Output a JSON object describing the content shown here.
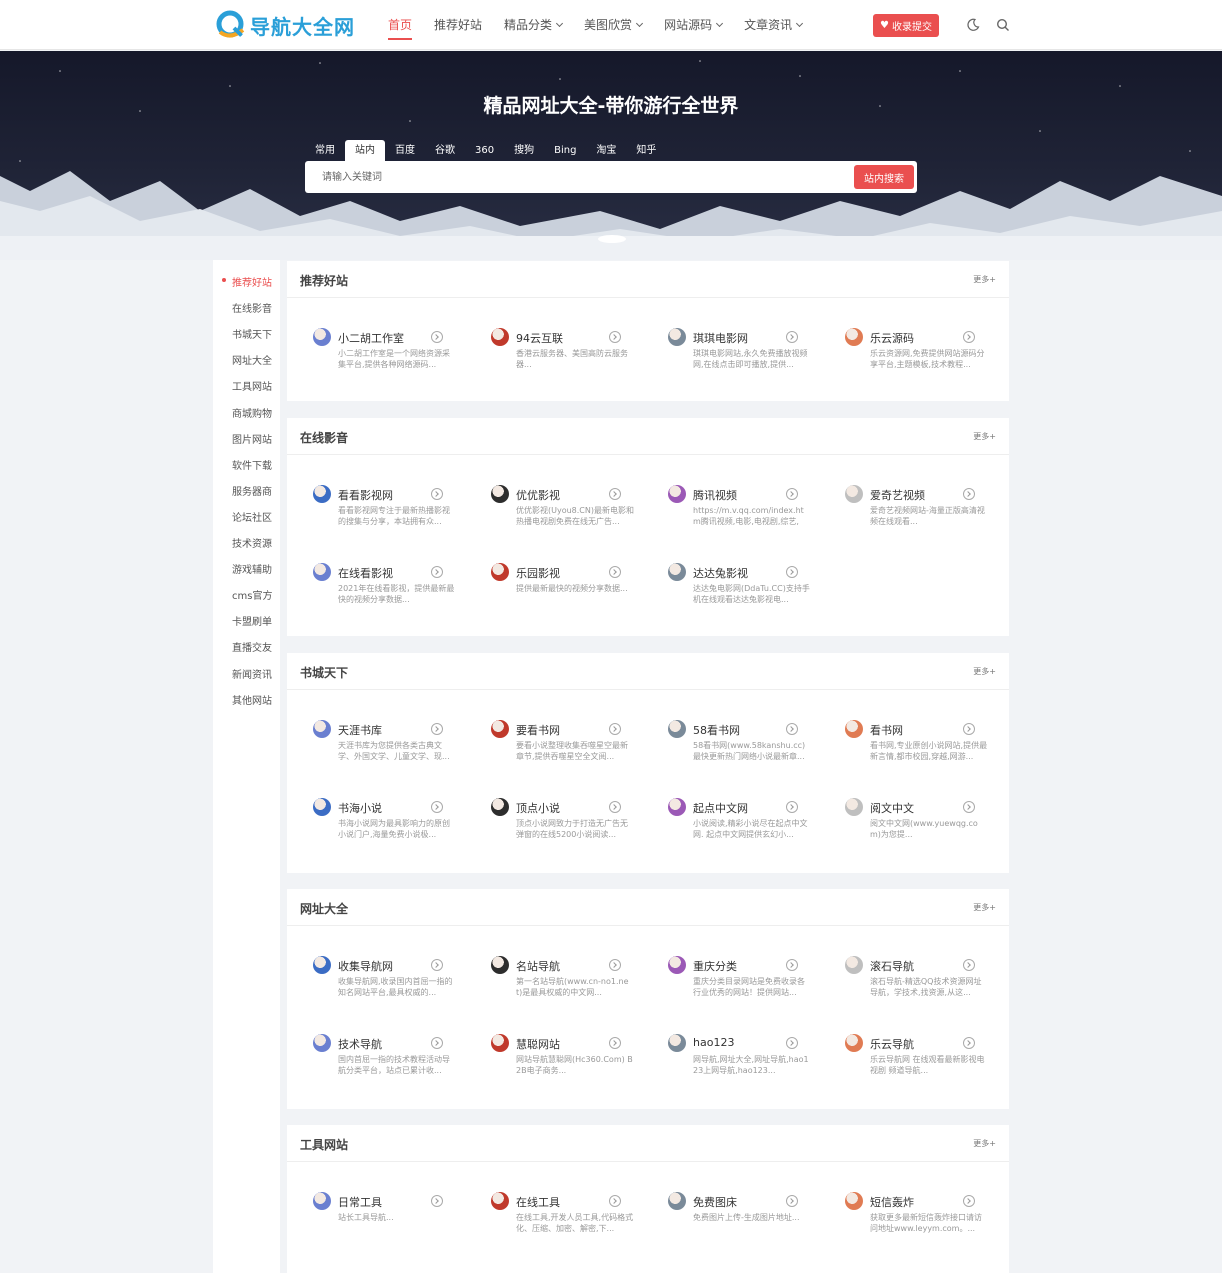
{
  "logo": {
    "text": "导航大全网"
  },
  "nav": [
    {
      "label": "首页",
      "active": true,
      "dropdown": false
    },
    {
      "label": "推荐好站",
      "active": false,
      "dropdown": false
    },
    {
      "label": "精品分类",
      "active": false,
      "dropdown": true
    },
    {
      "label": "美图欣赏",
      "active": false,
      "dropdown": true
    },
    {
      "label": "网站源码",
      "active": false,
      "dropdown": true
    },
    {
      "label": "文章资讯",
      "active": false,
      "dropdown": true
    }
  ],
  "header": {
    "submit_label": "收录提交",
    "submit_icon": "heart-icon",
    "theme_icon": "moon-icon",
    "search_icon": "search-icon"
  },
  "banner": {
    "title": "精品网址大全-带你游行全世界",
    "tabs": [
      "常用",
      "站内",
      "百度",
      "谷歌",
      "360",
      "搜狗",
      "Bing",
      "淘宝",
      "知乎"
    ],
    "active_tab": "站内",
    "search_placeholder": "请输入关键词",
    "search_button": "站内搜索"
  },
  "side": {
    "active": "推荐好站",
    "items": [
      "推荐好站",
      "在线影音",
      "书城天下",
      "网址大全",
      "工具网站",
      "商城购物",
      "图片网站",
      "软件下载",
      "服务器商",
      "论坛社区",
      "技术资源",
      "游戏辅助",
      "cms官方",
      "卡盟刷单",
      "直播交友",
      "新闻资讯",
      "其他网站"
    ]
  },
  "more_label": "更多+",
  "colors": {
    "accent": "#ea4f4f",
    "banner_dark": "#1f2336"
  },
  "sections": [
    {
      "title": "推荐好站",
      "items": [
        {
          "name": "小二胡工作室",
          "desc": "小二胡工作室是一个网络资源采集平台,提供各种网络源码..."
        },
        {
          "name": "94云互联",
          "desc": "香港云服务器、美国高防云服务器..."
        },
        {
          "name": "琪琪电影网",
          "desc": "琪琪电影网站,永久免费播放视频网,在线点击即可播放,提供..."
        },
        {
          "name": "乐云源码",
          "desc": "乐云资源网,免费提供网站源码分享平台,主题模板,技术教程..."
        }
      ]
    },
    {
      "title": "在线影音",
      "items": [
        {
          "name": "看看影视网",
          "desc": "看看影视网专注于最新热播影视的搜集与分享，本站拥有众..."
        },
        {
          "name": "优优影视",
          "desc": "优优影视(Uyou8.CN)最新电影和热播电视剧免费在线无广告..."
        },
        {
          "name": "腾讯视频",
          "desc": "https://m.v.qq.com/index.htm腾讯视频,电影,电视剧,综艺,新..."
        },
        {
          "name": "爱奇艺视频",
          "desc": "爱奇艺视频网站-海量正版高清视频在线观看..."
        },
        {
          "name": "在线看影视",
          "desc": "2021年在线看影视，提供最新最快的视频分享数据..."
        },
        {
          "name": "乐园影视",
          "desc": "提供最新最快的视频分享数据..."
        },
        {
          "name": "达达兔影视",
          "desc": "达达兔电影网(DdaTu.CC)支持手机在线观看达达兔影视电..."
        }
      ]
    },
    {
      "title": "书城天下",
      "items": [
        {
          "name": "天涯书库",
          "desc": "天涯书库为您提供各类古典文学、外国文学、儿童文学、现..."
        },
        {
          "name": "要看书网",
          "desc": "要看小说整理收集吞噬星空最新章节,提供吞噬星空全文阅..."
        },
        {
          "name": "58看书网",
          "desc": "58看书网(www.58kanshu.cc)最快更新热门网络小说最新章..."
        },
        {
          "name": "看书网",
          "desc": "看书网,专业原创小说网站,提供最新言情,都市校园,穿越,网游..."
        },
        {
          "name": "书海小说",
          "desc": "书海小说网为最具影响力的原创小说门户,海量免费小说极..."
        },
        {
          "name": "顶点小说",
          "desc": "顶点小说网致力于打造无广告无弹窗的在线5200小说阅读..."
        },
        {
          "name": "起点中文网",
          "desc": "小说阅读,精彩小说尽在起点中文网. 起点中文网提供玄幻小..."
        },
        {
          "name": "阅文中文",
          "desc": "阅文中文网(www.yuewqg.com)为您提..."
        }
      ]
    },
    {
      "title": "网址大全",
      "items": [
        {
          "name": "收集导航网",
          "desc": "收集导航网,收录国内首屈一指的知名网站平台,最具权威的..."
        },
        {
          "name": "名站导航",
          "desc": "第一名站导航(www.cn-no1.net)是最具权威的中文网..."
        },
        {
          "name": "重庆分类",
          "desc": "重庆分类目录网站是免费收录各行业优秀的网站！提供网站..."
        },
        {
          "name": "滚石导航",
          "desc": "滚石导航-精选QQ技术资源网址导航，学技术,找资源,从这..."
        },
        {
          "name": "技术导航",
          "desc": "国内首屈一指的技术教程活动导航分类平台，站点已累计收..."
        },
        {
          "name": "慧聪网站",
          "desc": "网站导航慧聪网(Hc360.Com) B2B电子商务..."
        },
        {
          "name": "hao123",
          "desc": "网导航,网址大全,网址导航,hao123上网导航,hao123..."
        },
        {
          "name": "乐云导航",
          "desc": "乐云导航网 在线观看最新影视电视剧 频道导航..."
        }
      ]
    },
    {
      "title": "工具网站",
      "items": [
        {
          "name": "日常工具",
          "desc": "站长工具导航..."
        },
        {
          "name": "在线工具",
          "desc": "在线工具,开发人员工具,代码格式化、压缩、加密、解密,下..."
        },
        {
          "name": "免费图床",
          "desc": "免费图片上传-生成图片地址..."
        },
        {
          "name": "短信轰炸",
          "desc": "获取更多最新短信轰炸接口请访问地址www.leyym.com。..."
        }
      ]
    }
  ]
}
